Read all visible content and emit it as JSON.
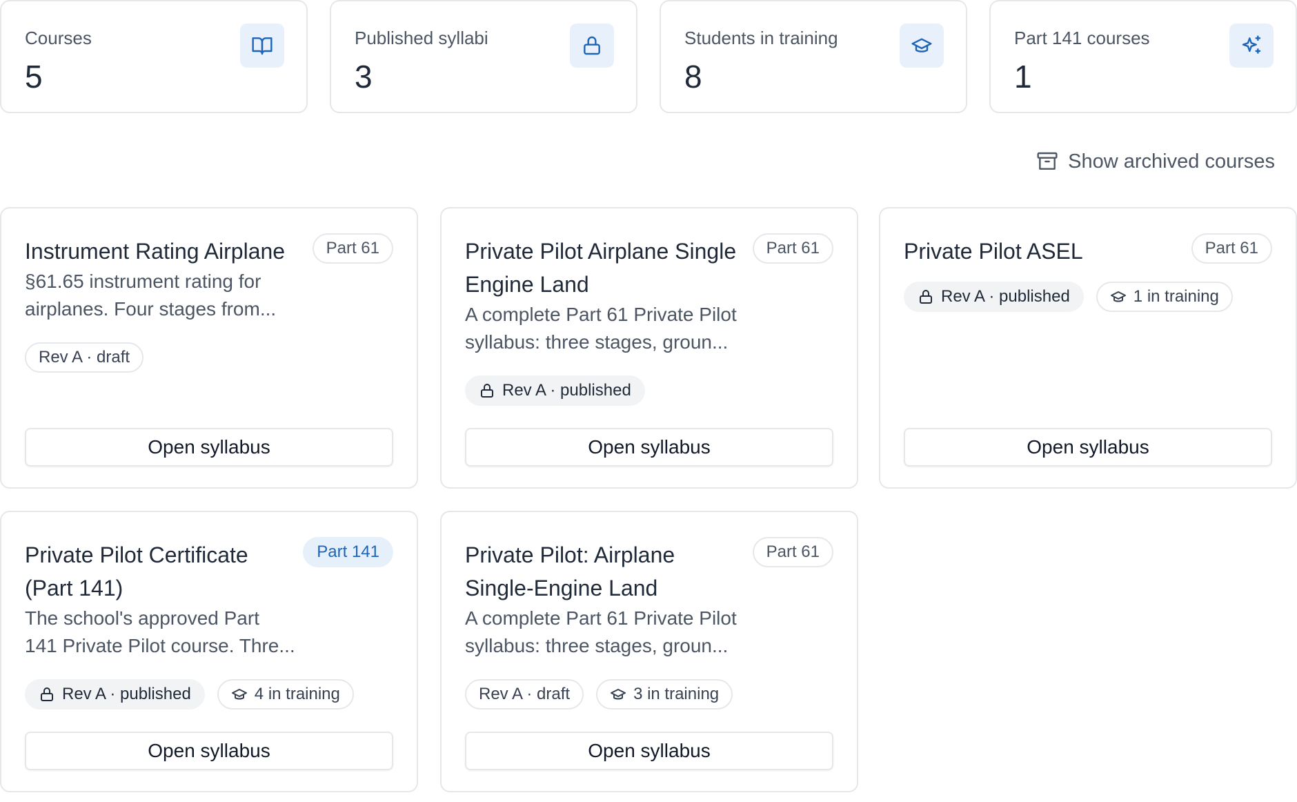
{
  "stats": [
    {
      "label": "Courses",
      "value": "5",
      "icon": "book-icon"
    },
    {
      "label": "Published syllabi",
      "value": "3",
      "icon": "lock-icon"
    },
    {
      "label": "Students in training",
      "value": "8",
      "icon": "graduation-cap-icon"
    },
    {
      "label": "Part 141 courses",
      "value": "1",
      "icon": "sparkles-icon"
    }
  ],
  "archived_toggle": {
    "label": "Show archived courses",
    "icon": "archive-icon"
  },
  "colors": {
    "accent": "#1d64b8",
    "accent_bg": "#e8f1fb",
    "border": "#e5e7eb",
    "muted_text": "#4b5563"
  },
  "courses": [
    {
      "title": "Instrument Rating Airplane",
      "part": "Part 61",
      "description_lines": [
        "§61.65 instrument rating for",
        "airplanes. Four stages from..."
      ],
      "revision": "Rev A · draft",
      "training": "",
      "button": "Open syllabus"
    },
    {
      "title": "Private Pilot Airplane Single Engine Land",
      "part": "Part 61",
      "description_lines": [
        "A complete Part 61 Private Pilot",
        "syllabus: three stages, groun..."
      ],
      "revision": "Rev A · published",
      "training": "",
      "button": "Open syllabus"
    },
    {
      "title": "Private Pilot ASEL",
      "part": "Part 61",
      "description_lines": [],
      "revision": "Rev A · published",
      "training": "1 in training",
      "button": "Open syllabus"
    },
    {
      "title": "Private Pilot Certificate (Part 141)",
      "part": "Part 141",
      "description_lines": [
        "The school's approved Part",
        "141 Private Pilot course. Thre..."
      ],
      "revision": "Rev A · published",
      "training": "4 in training",
      "button": "Open syllabus"
    },
    {
      "title": "Private Pilot: Airplane Single-Engine Land",
      "part": "Part 61",
      "description_lines": [
        "A complete Part 61 Private Pilot",
        "syllabus: three stages, groun..."
      ],
      "revision": "Rev A · draft",
      "training": "3 in training",
      "button": "Open syllabus"
    }
  ]
}
